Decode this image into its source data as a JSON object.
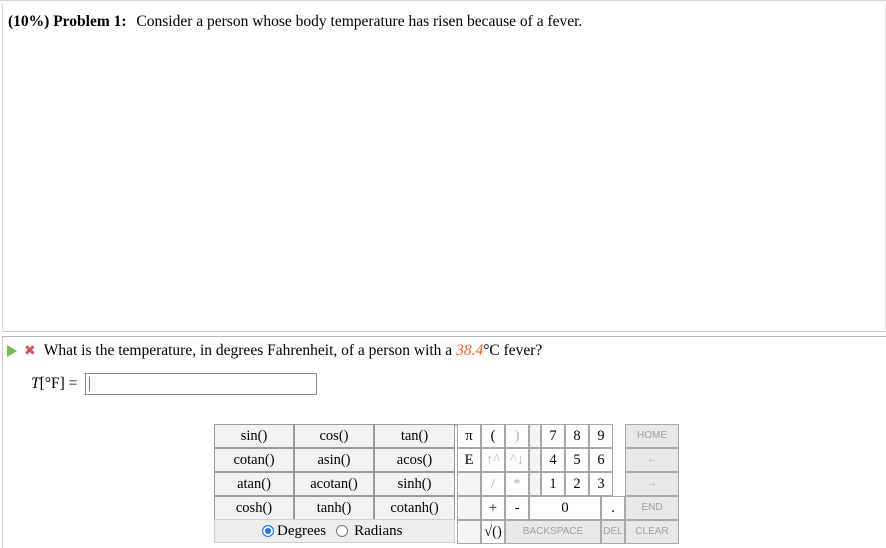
{
  "problem": {
    "label": "(10%) Problem 1:",
    "text": "Consider a person whose body temperature has risen because of a fever."
  },
  "question": {
    "prefix": "What is the temperature, in degrees Fahrenheit, of a person with a",
    "value": "38.4",
    "suffix": "°C fever?",
    "status_icon": "x-icon",
    "play_icon": "play-icon"
  },
  "answer": {
    "label_var": "T",
    "label_unit": "[°F] =",
    "value": ""
  },
  "keypad": {
    "functions": [
      [
        "sin()",
        "cos()",
        "tan()"
      ],
      [
        "cotan()",
        "asin()",
        "acos()"
      ],
      [
        "atan()",
        "acotan()",
        "sinh()"
      ],
      [
        "cosh()",
        "tanh()",
        "cotanh()"
      ]
    ],
    "symbols": {
      "pi": "π",
      "lparen": "(",
      "rparen": ")",
      "e": "E",
      "pow": "↑^",
      "caret2": "^↓",
      "slash": "/",
      "star": "*",
      "plus": "+",
      "minus": "-",
      "sqrt": "√()"
    },
    "digits": {
      "d7": "7",
      "d8": "8",
      "d9": "9",
      "d4": "4",
      "d5": "5",
      "d6": "6",
      "d1": "1",
      "d2": "2",
      "d3": "3",
      "d0": "0",
      "dot": "."
    },
    "specials": {
      "home": "HOME",
      "left": "←",
      "right": "→",
      "end": "END",
      "backspace": "BACKSPACE",
      "del": "DEL",
      "clear": "CLEAR"
    },
    "angle": {
      "degrees": "Degrees",
      "radians": "Radians",
      "selected": "Degrees"
    }
  },
  "colors": {
    "accent": "#e8632b",
    "ok": "#6fbf4a",
    "error": "#d9534f",
    "radio": "#1a73e8"
  }
}
